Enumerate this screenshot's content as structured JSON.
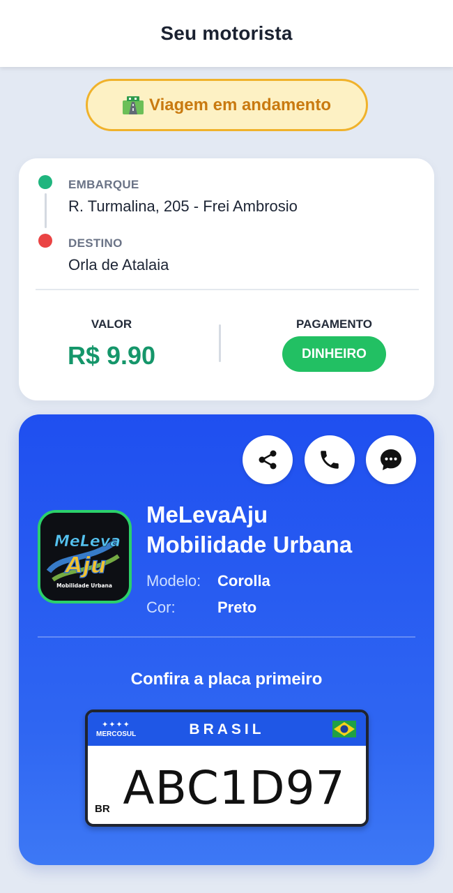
{
  "header": {
    "title": "Seu motorista"
  },
  "status": {
    "icon": "road-icon",
    "label": "Viagem em andamento",
    "color": "#c97a10"
  },
  "route": {
    "pickup": {
      "label": "EMBARQUE",
      "address": "R. Turmalina, 205 - Frei Ambrosio"
    },
    "destination": {
      "label": "DESTINO",
      "address": "Orla de Atalaia"
    }
  },
  "fare": {
    "value_label": "VALOR",
    "value": "R$ 9.90",
    "payment_label": "PAGAMENTO",
    "payment_method": "DINHEIRO"
  },
  "driver": {
    "actions": [
      {
        "name": "share",
        "icon": "share-icon"
      },
      {
        "name": "call",
        "icon": "phone-icon"
      },
      {
        "name": "chat",
        "icon": "chat-icon"
      }
    ],
    "logo": {
      "text_top": "MeLeva",
      "text_main": "Aju",
      "text_sub": "Mobilidade Urbana"
    },
    "company_line1": "MeLevaAju",
    "company_line2": "Mobilidade Urbana",
    "model_label": "Modelo:",
    "model": "Corolla",
    "color_label": "Cor:",
    "color": "Preto",
    "plate_hint": "Confira a placa primeiro",
    "plate": {
      "stars": "✦✦✦✦",
      "bloc": "MERCOSUL",
      "country": "BRASIL",
      "prefix": "BR",
      "number": "ABC1D97"
    }
  },
  "colors": {
    "accent_blue": "#1f4ff0",
    "green": "#22c063",
    "price_green": "#15966a",
    "warning_border": "#f0b22b"
  }
}
